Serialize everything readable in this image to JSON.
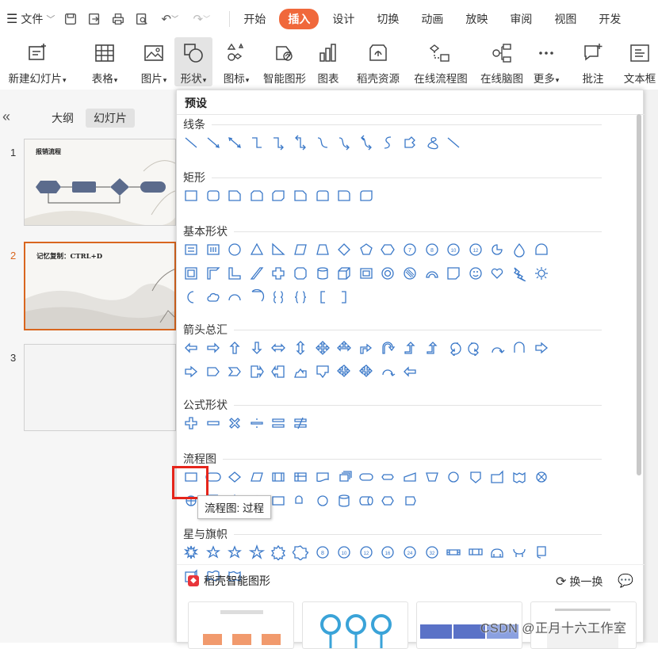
{
  "menubar": {
    "menu_icon": "hamburger-icon",
    "file_label": "文件",
    "tabs": [
      {
        "label": "开始",
        "active": false
      },
      {
        "label": "插入",
        "active": true
      },
      {
        "label": "设计",
        "active": false
      },
      {
        "label": "切换",
        "active": false
      },
      {
        "label": "动画",
        "active": false
      },
      {
        "label": "放映",
        "active": false
      },
      {
        "label": "审阅",
        "active": false
      },
      {
        "label": "视图",
        "active": false
      },
      {
        "label": "开发",
        "active": false
      }
    ],
    "accent_color": "#f0683b"
  },
  "ribbon": {
    "items": [
      {
        "label": "新建幻灯片",
        "caret": true,
        "icon": "new-slide-icon"
      },
      {
        "label": "表格",
        "caret": true,
        "icon": "table-icon"
      },
      {
        "label": "图片",
        "caret": true,
        "icon": "picture-icon"
      },
      {
        "label": "形状",
        "caret": true,
        "icon": "shape-icon",
        "active": true
      },
      {
        "label": "图标",
        "caret": true,
        "icon": "icons-icon"
      },
      {
        "label": "智能图形",
        "caret": false,
        "icon": "smartart-icon"
      },
      {
        "label": "图表",
        "caret": false,
        "icon": "chart-icon"
      },
      {
        "label": "稻壳资源",
        "caret": false,
        "icon": "resource-icon"
      },
      {
        "label": "在线流程图",
        "caret": false,
        "icon": "flowchart-icon"
      },
      {
        "label": "在线脑图",
        "caret": false,
        "icon": "mindmap-icon"
      },
      {
        "label": "更多",
        "caret": true,
        "icon": "more-icon"
      },
      {
        "label": "批注",
        "caret": false,
        "icon": "comment-icon"
      },
      {
        "label": "文本框",
        "caret": false,
        "icon": "textbox-icon"
      }
    ]
  },
  "left_pane": {
    "tabs": [
      {
        "label": "大纲",
        "selected": false
      },
      {
        "label": "幻灯片",
        "selected": true
      }
    ],
    "slides": [
      {
        "number": "1",
        "title": "报销流程"
      },
      {
        "number": "2",
        "title": "记忆复制：CTRL+D"
      },
      {
        "number": "3",
        "title": ""
      }
    ]
  },
  "shapes_panel": {
    "header": "预设",
    "categories": [
      {
        "label": "线条",
        "count": 13
      },
      {
        "label": "矩形",
        "count": 9
      },
      {
        "label": "基本形状",
        "count": 42
      },
      {
        "label": "箭头总汇",
        "count": 28
      },
      {
        "label": "公式形状",
        "count": 6
      },
      {
        "label": "流程图",
        "count": 28
      },
      {
        "label": "星与旗帜",
        "count": 20
      }
    ],
    "tooltip": "流程图: 过程",
    "footer_title": "稻壳智能图形",
    "refresh_label": "换一换",
    "highlight_color": "#e5251b"
  },
  "watermark": "CSDN @正月十六工作室"
}
